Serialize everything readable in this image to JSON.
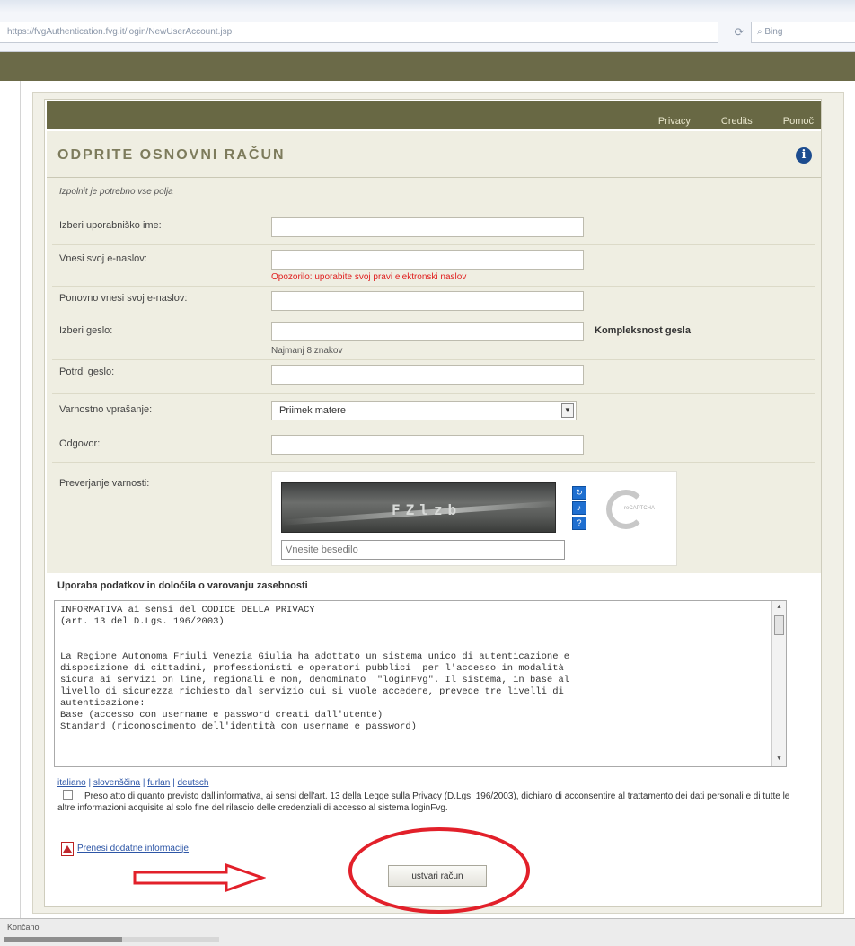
{
  "browser": {
    "url": "https://fvgAuthentication.fvg.it/login/NewUserAccount.jsp",
    "search_placeholder": "Bing"
  },
  "nav": {
    "privacy": "Privacy",
    "credits": "Credits",
    "contact": "Pomoč"
  },
  "page": {
    "title": "ODPRITE OSNOVNI RAČUN",
    "required_note": "Izpolnit je potrebno vse polja"
  },
  "form": {
    "username_label": "Izberi uporabniško ime:",
    "email_label": "Vnesi svoj e-naslov:",
    "email_error": "Opozorilo: uporabite svoj pravi elektronski naslov",
    "email_confirm_label": "Ponovno vnesi svoj e-naslov:",
    "password_label": "Izberi geslo:",
    "password_strength": "Kompleksnost gesla",
    "password_hint": "Najmanj 8 znakov",
    "password_confirm_label": "Potrdi geslo:",
    "security_question_label": "Varnostno vprašanje:",
    "security_question_value": "Priimek matere",
    "answer_label": "Odgovor:",
    "captcha_label": "Preverjanje varnosti:",
    "captcha_text": "FZlzb",
    "captcha_placeholder": "Vnesite besedilo",
    "captcha_logo_text": "reCAPTCHA"
  },
  "terms": {
    "heading": "Uporaba podatkov in določila o varovanju zasebnosti",
    "lines": [
      "INFORMATIVA ai sensi del CODICE DELLA PRIVACY",
      "(art. 13 del D.Lgs. 196/2003)",
      "",
      "",
      "La Regione Autonoma Friuli Venezia Giulia ha adottato un sistema unico di autenticazione e",
      "disposizione di cittadini, professionisti e operatori pubblici  per l'accesso in modalità",
      "sicura ai servizi on line, regionali e non, denominato  \"loginFvg\". Il sistema, in base al",
      "livello di sicurezza richiesto dal servizio cui si vuole accedere, prevede tre livelli di",
      "autenticazione:",
      "Base (accesso con username e password creati dall'utente)",
      "Standard (riconoscimento dell'identità con username e password)"
    ]
  },
  "languages": [
    "italiano",
    "slovenščina",
    "furlan",
    "deutsch"
  ],
  "consent": {
    "text": "Preso atto di quanto previsto dall'informativa, ai sensi dell'art. 13 della Legge sulla Privacy (D.Lgs. 196/2003), dichiaro di acconsentire al trattamento dei dati personali e di tutte le altre informazioni acquisite al solo fine del rilascio delle credenziali di accesso al sistema loginFvg."
  },
  "pdf_link": "Prenesi dodatne informacije",
  "submit_label": "ustvari račun",
  "status": {
    "text": "Končano",
    "progress": 0.55
  },
  "colors": {
    "olive_band": "#6b6a48",
    "header_green": "#686844",
    "panel_beige": "#efeee2",
    "error_red": "#e02020",
    "annotation_red": "#e2202a",
    "link_blue": "#2c55a6"
  }
}
